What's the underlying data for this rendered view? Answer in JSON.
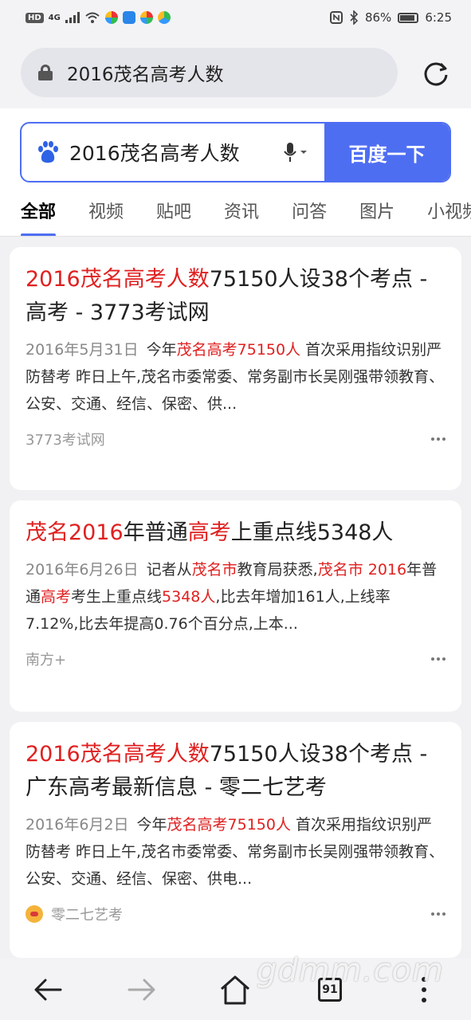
{
  "status": {
    "network_badge": "HD",
    "network_type": "4G",
    "battery_percent": "86%",
    "time": "6:25"
  },
  "browser": {
    "url_text": "2016茂名高考人数"
  },
  "search": {
    "query": "2016茂名高考人数",
    "button_label": "百度一下",
    "tabs": [
      "全部",
      "视频",
      "贴吧",
      "资讯",
      "问答",
      "图片",
      "小视频"
    ],
    "active_tab": "全部"
  },
  "results": [
    {
      "title_hl": "2016茂名高考人数",
      "title_rest": "75150人设38个考点 - 高考 - 3773考试网",
      "date": "2016年5月31日",
      "snip_a": "今年",
      "snip_hl1": "茂名高考75150人",
      "snip_b": " 首次采用指纹识别严防替考 昨日上午,茂名市委常委、常务副市长吴刚强带领教育、公安、交通、经信、保密、供...",
      "source": "3773考试网"
    },
    {
      "title_hl1": "茂名2016",
      "title_mid": "年普通",
      "title_hl2": "高考",
      "title_rest": "上重点线5348人",
      "date": "2016年6月26日",
      "snip_a": "记者从",
      "snip_hl1": "茂名市",
      "snip_b": "教育局获悉,",
      "snip_hl2": "茂名市 2016",
      "snip_c": "年普通",
      "snip_hl3": "高考",
      "snip_d": "考生上重点线",
      "snip_hl4": "5348人",
      "snip_e": ",比去年增加161人,上线率 7.12%,比去年提高0.76个百分点,上本...",
      "source": "南方+"
    },
    {
      "title_hl": "2016茂名高考人数",
      "title_rest": "75150人设38个考点 - 广东高考最新信息 - 零二七艺考",
      "date": "2016年6月2日",
      "snip_a": "今年",
      "snip_hl1": "茂名高考75150人",
      "snip_b": " 首次采用指纹识别严防替考 昨日上午,茂名市委常委、常务副市长吴刚强带领教育、公安、交通、经信、保密、供电...",
      "source": "零二七艺考"
    }
  ],
  "bottom_nav": {
    "tab_count": "91"
  },
  "watermark": "gdmm.com",
  "colors": {
    "accent": "#4e6ef2",
    "highlight": "#e02020"
  }
}
